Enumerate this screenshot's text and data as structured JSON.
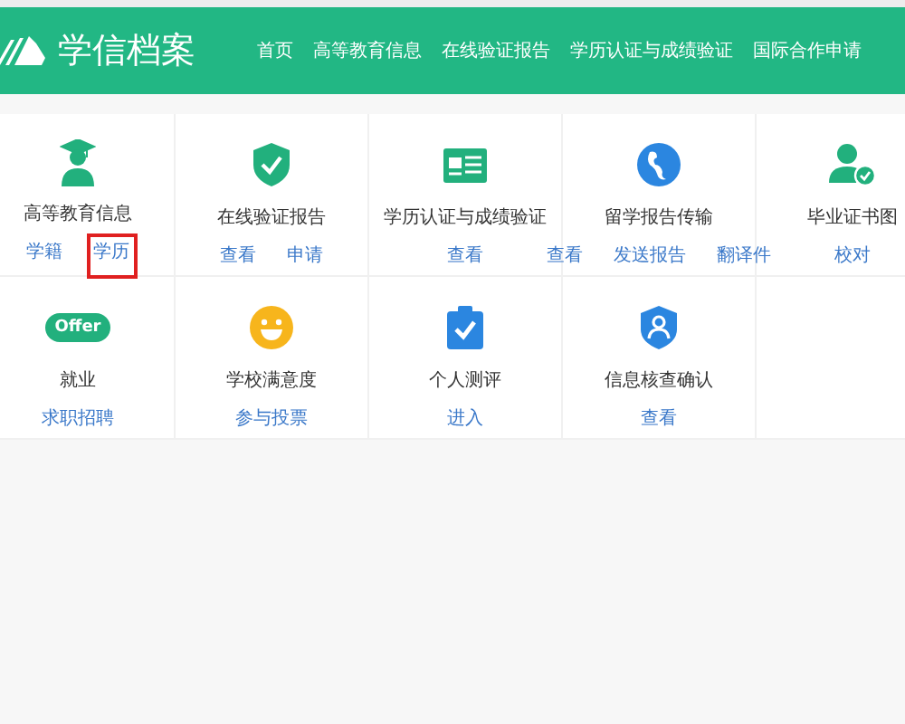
{
  "header": {
    "logo_text": "学信档案",
    "nav": [
      {
        "label": "首页"
      },
      {
        "label": "高等教育信息"
      },
      {
        "label": "在线验证报告"
      },
      {
        "label": "学历认证与成绩验证"
      },
      {
        "label": "国际合作申请"
      }
    ]
  },
  "services": [
    {
      "kind": "graduate",
      "title": "高等教育信息",
      "links": [
        {
          "label": "学籍",
          "highlighted": false
        },
        {
          "label": "学历",
          "highlighted": true
        }
      ]
    },
    {
      "kind": "shield",
      "title": "在线验证报告",
      "links": [
        {
          "label": "查看",
          "highlighted": false
        },
        {
          "label": "申请",
          "highlighted": false
        }
      ]
    },
    {
      "kind": "card",
      "title": "学历认证与成绩验证",
      "links": [
        {
          "label": "查看",
          "highlighted": false
        }
      ]
    },
    {
      "kind": "globe",
      "title": "留学报告传输",
      "links": [
        {
          "label": "查看",
          "highlighted": false
        },
        {
          "label": "发送报告",
          "highlighted": false
        },
        {
          "label": "翻译件",
          "highlighted": false
        }
      ]
    },
    {
      "kind": "person",
      "title": "毕业证书图",
      "links": [
        {
          "label": "校对",
          "highlighted": false
        }
      ]
    },
    {
      "kind": "badge",
      "badge": "Offer",
      "title": "就业",
      "links": [
        {
          "label": "求职招聘",
          "highlighted": false
        }
      ]
    },
    {
      "kind": "smiley",
      "title": "学校满意度",
      "links": [
        {
          "label": "参与投票",
          "highlighted": false
        }
      ]
    },
    {
      "kind": "clipboard",
      "title": "个人测评",
      "links": [
        {
          "label": "进入",
          "highlighted": false
        }
      ]
    },
    {
      "kind": "badge-person",
      "title": "信息核查确认",
      "links": [
        {
          "label": "查看",
          "highlighted": false
        }
      ]
    }
  ]
}
